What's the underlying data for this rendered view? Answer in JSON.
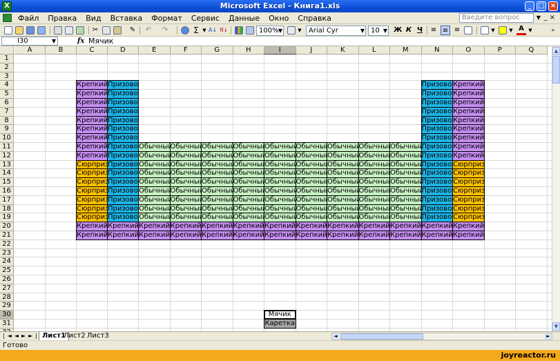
{
  "window": {
    "title": "Microsoft Excel - Книга1.xls",
    "app_icon": "X"
  },
  "menu": {
    "items": [
      "Файл",
      "Правка",
      "Вид",
      "Вставка",
      "Формат",
      "Сервис",
      "Данные",
      "Окно",
      "Справка"
    ],
    "help_placeholder": "Введите вопрос"
  },
  "toolbar": {
    "zoom": "100%",
    "font_name": "Arial Cyr",
    "font_size": "10",
    "bold_label": "Ж",
    "italic_label": "К",
    "underline_label": "Ч",
    "sum_label": "Σ"
  },
  "formula_bar": {
    "name_box": "I30",
    "fx": "fx",
    "content": "Мячик"
  },
  "columns": [
    "A",
    "B",
    "C",
    "D",
    "E",
    "F",
    "G",
    "H",
    "I",
    "J",
    "K",
    "L",
    "M",
    "N",
    "O",
    "P",
    "Q"
  ],
  "selected_column": "I",
  "rows": [
    1,
    2,
    3,
    4,
    5,
    6,
    7,
    8,
    9,
    10,
    11,
    12,
    13,
    14,
    15,
    16,
    17,
    18,
    19,
    20,
    21,
    22,
    23,
    24,
    25,
    26,
    27,
    28,
    29,
    30,
    31,
    32
  ],
  "selected_row": 30,
  "cell_types": {
    "K": {
      "label": "Крепкий",
      "color": "#c58ef0"
    },
    "P": {
      "label": "Призовой",
      "color": "#1fb4e6"
    },
    "O": {
      "label": "Обычный",
      "color": "#c6f0c2"
    },
    "S": {
      "label": "Сюрприз",
      "color": "#ffc000"
    }
  },
  "block_rows": [
    {
      "row": 4,
      "C": "K",
      "D": "P",
      "N": "P",
      "O": "K"
    },
    {
      "row": 5,
      "C": "K",
      "D": "P",
      "N": "P",
      "O": "K"
    },
    {
      "row": 6,
      "C": "K",
      "D": "P",
      "N": "P",
      "O": "K"
    },
    {
      "row": 7,
      "C": "K",
      "D": "P",
      "N": "P",
      "O": "K"
    },
    {
      "row": 8,
      "C": "K",
      "D": "P",
      "N": "P",
      "O": "K"
    },
    {
      "row": 9,
      "C": "K",
      "D": "P",
      "N": "P",
      "O": "K"
    },
    {
      "row": 10,
      "C": "K",
      "D": "P",
      "N": "P",
      "O": "K"
    },
    {
      "row": 11,
      "C": "K",
      "D": "P",
      "E": "O",
      "F": "O",
      "G": "O",
      "H": "O",
      "I": "O",
      "J": "O",
      "K": "O",
      "L": "O",
      "M": "O",
      "N": "P",
      "O": "K"
    },
    {
      "row": 12,
      "C": "K",
      "D": "P",
      "E": "O",
      "F": "O",
      "G": "O",
      "H": "O",
      "I": "O",
      "J": "O",
      "K": "O",
      "L": "O",
      "M": "O",
      "N": "P",
      "O": "K"
    },
    {
      "row": 13,
      "C": "S",
      "D": "P",
      "E": "O",
      "F": "O",
      "G": "O",
      "H": "O",
      "I": "O",
      "J": "O",
      "K": "O",
      "L": "O",
      "M": "O",
      "N": "P",
      "O": "S"
    },
    {
      "row": 14,
      "C": "S",
      "D": "P",
      "E": "O",
      "F": "O",
      "G": "O",
      "H": "O",
      "I": "O",
      "J": "O",
      "K": "O",
      "L": "O",
      "M": "O",
      "N": "P",
      "O": "S"
    },
    {
      "row": 15,
      "C": "S",
      "D": "P",
      "E": "O",
      "F": "O",
      "G": "O",
      "H": "O",
      "I": "O",
      "J": "O",
      "K": "O",
      "L": "O",
      "M": "O",
      "N": "P",
      "O": "S"
    },
    {
      "row": 16,
      "C": "S",
      "D": "P",
      "E": "O",
      "F": "O",
      "G": "O",
      "H": "O",
      "I": "O",
      "J": "O",
      "K": "O",
      "L": "O",
      "M": "O",
      "N": "P",
      "O": "S"
    },
    {
      "row": 17,
      "C": "S",
      "D": "P",
      "E": "O",
      "F": "O",
      "G": "O",
      "H": "O",
      "I": "O",
      "J": "O",
      "K": "O",
      "L": "O",
      "M": "O",
      "N": "P",
      "O": "S"
    },
    {
      "row": 18,
      "C": "S",
      "D": "P",
      "E": "O",
      "F": "O",
      "G": "O",
      "H": "O",
      "I": "O",
      "J": "O",
      "K": "O",
      "L": "O",
      "M": "O",
      "N": "P",
      "O": "S"
    },
    {
      "row": 19,
      "C": "S",
      "D": "P",
      "E": "O",
      "F": "O",
      "G": "O",
      "H": "O",
      "I": "O",
      "J": "O",
      "K": "O",
      "L": "O",
      "M": "O",
      "N": "P",
      "O": "S"
    },
    {
      "row": 20,
      "C": "K",
      "D": "K",
      "E": "K",
      "F": "K",
      "G": "K",
      "H": "K",
      "I": "K",
      "J": "K",
      "K": "K",
      "L": "K",
      "M": "K",
      "N": "K",
      "O": "K"
    },
    {
      "row": 21,
      "C": "K",
      "D": "K",
      "E": "K",
      "F": "K",
      "G": "K",
      "H": "K",
      "I": "K",
      "J": "K",
      "K": "K",
      "L": "K",
      "M": "K",
      "N": "K",
      "O": "K"
    }
  ],
  "special_cells": [
    {
      "row": 30,
      "col": "I",
      "label": "Мячик",
      "color": "#ffffff",
      "selected": true
    },
    {
      "row": 31,
      "col": "I",
      "label": "Каретка",
      "color": "#a6a6a6",
      "selected": false
    }
  ],
  "sheets": [
    "Лист1",
    "Лист2",
    "Лист3"
  ],
  "active_sheet": 0,
  "status": "Готово",
  "watermark": "joyreactor.ru"
}
